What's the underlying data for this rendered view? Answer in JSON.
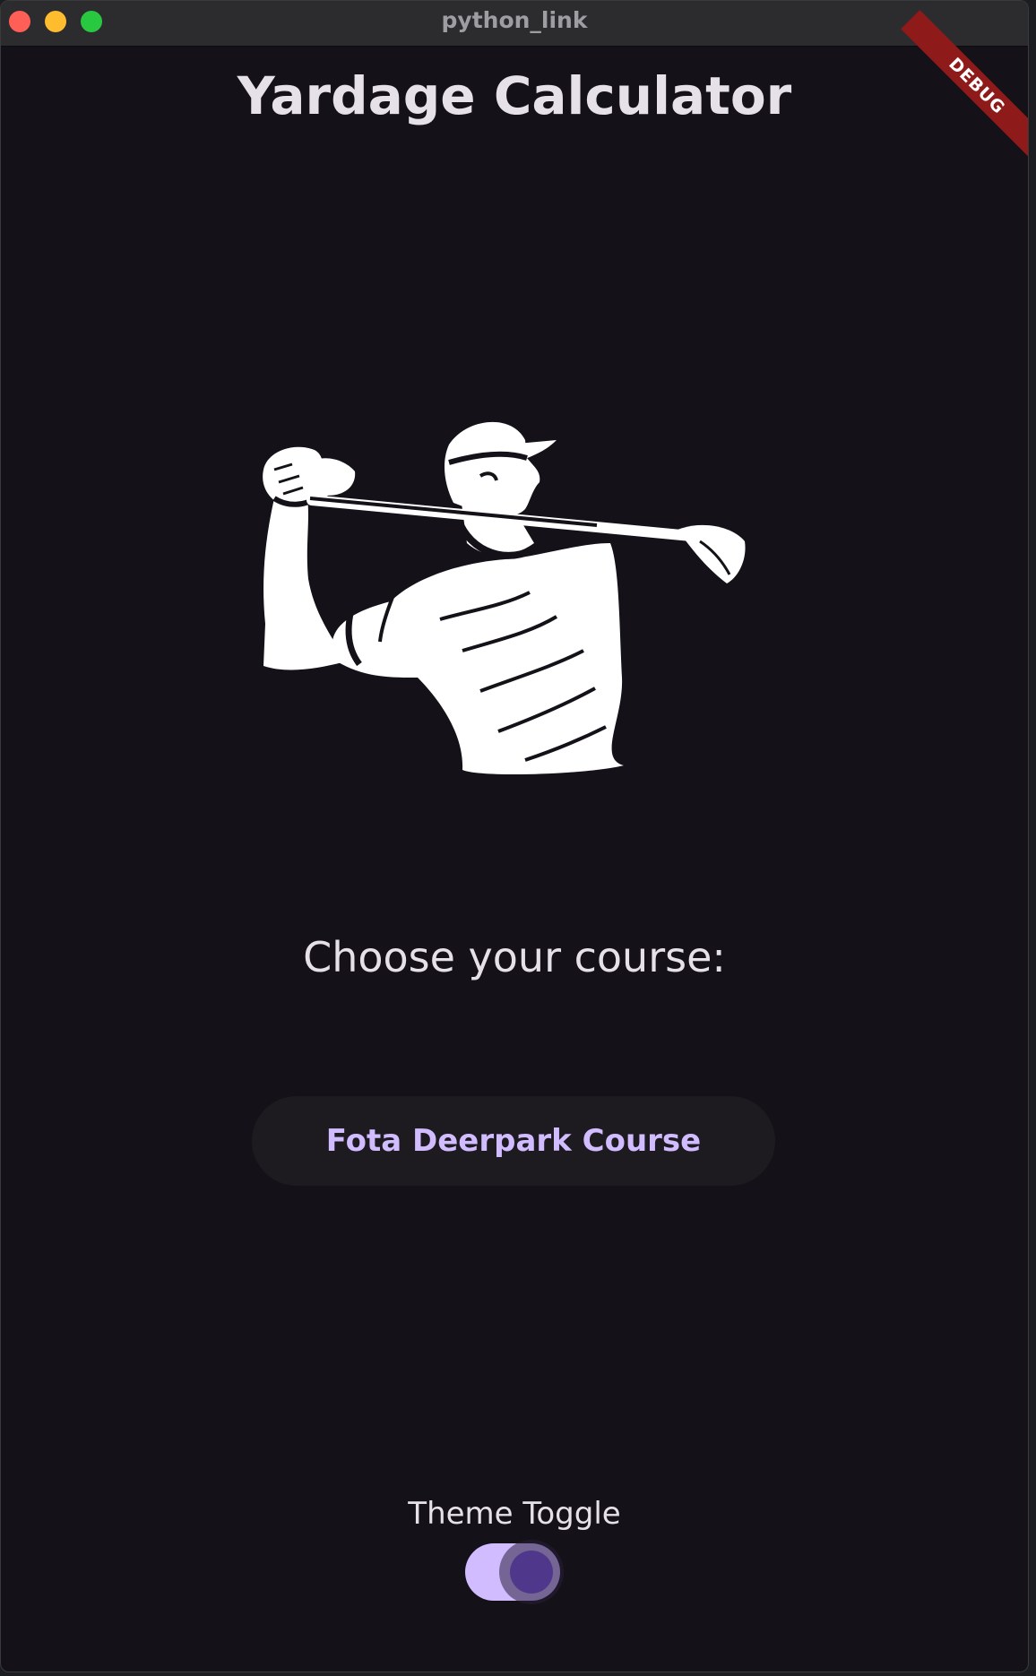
{
  "window": {
    "title": "python_link"
  },
  "debug_banner": {
    "label": "DEBUG"
  },
  "app": {
    "title": "Yardage Calculator",
    "illustration_icon": "golfer-swing-icon",
    "prompt": "Choose your course:",
    "course_button_label": "Fota Deerpark Course",
    "theme_toggle": {
      "label": "Theme Toggle",
      "checked": true
    }
  },
  "colors": {
    "background": "#141218",
    "primary_text": "#e6e0e9",
    "accent": "#d0bcff",
    "toggle_thumb": "#4f378b",
    "button_surface": "#1d1b20",
    "debug_banner": "#8e1a1a"
  }
}
